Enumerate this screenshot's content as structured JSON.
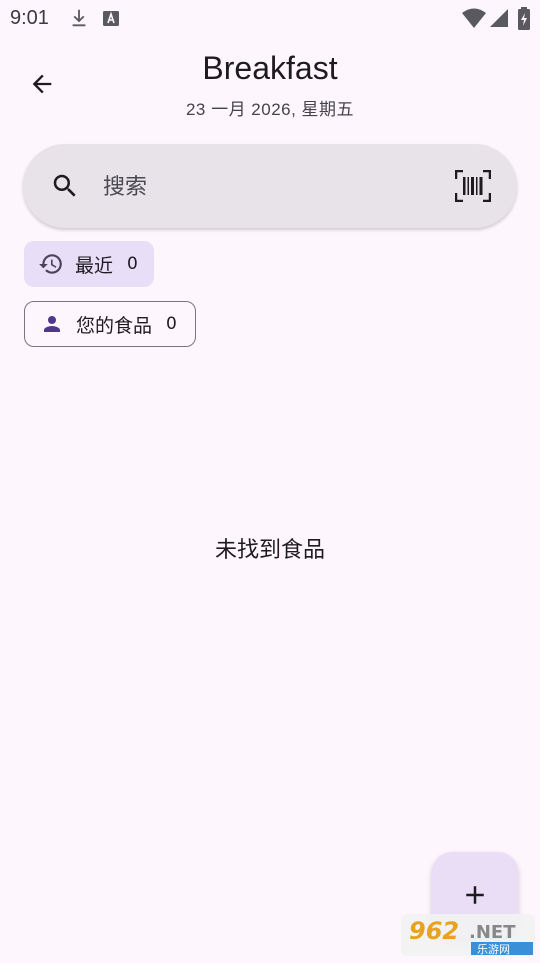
{
  "status_bar": {
    "time": "9:01",
    "left_icons": [
      "download-icon",
      "font-a-icon"
    ],
    "right_icons": [
      "wifi-icon",
      "signal-icon",
      "battery-charging-icon"
    ]
  },
  "header": {
    "title": "Breakfast",
    "subtitle": "23 一月 2026, 星期五",
    "back_icon": "arrow-back-icon"
  },
  "search": {
    "placeholder": "搜索",
    "icon": "search-icon",
    "scan_icon": "barcode-scan-icon"
  },
  "chips": [
    {
      "label": "最近",
      "count": "0",
      "icon": "history-icon",
      "selected": true
    },
    {
      "label": "您的食品",
      "count": "0",
      "icon": "person-icon",
      "selected": false
    }
  ],
  "empty_state": {
    "message": "未找到食品"
  },
  "fab": {
    "icon": "plus-icon"
  },
  "watermark": {
    "brand": "962",
    "suffix": ".NET",
    "sub": "乐游网"
  },
  "colors": {
    "background": "#fdf7fd",
    "search_bg": "#e8e2e9",
    "chip_selected": "#e8def8",
    "fab_bg": "#e9def6",
    "icon_accent": "#4f378b"
  }
}
